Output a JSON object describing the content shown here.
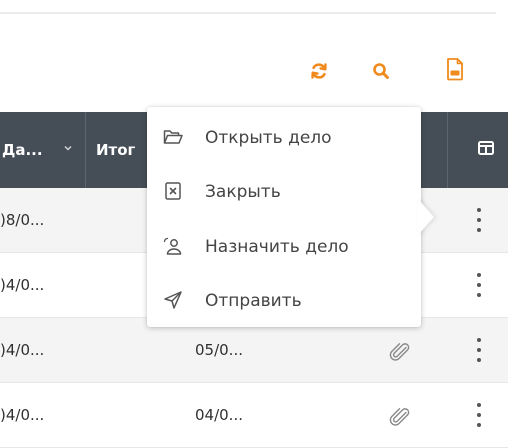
{
  "colors": {
    "accent": "#f08a1c",
    "header_bg": "#454d56",
    "icon_grey": "#666666"
  },
  "toolbar": {
    "icons": [
      "refresh-icon",
      "search-icon",
      "export-document-icon"
    ]
  },
  "table": {
    "columns": [
      {
        "label": "Да...",
        "sortable": true
      },
      {
        "label": "Итог"
      }
    ],
    "rows": [
      {
        "col1": ")8/0...",
        "col2": "",
        "attachment": false
      },
      {
        "col1": ")4/0...",
        "col2": "",
        "attachment": false
      },
      {
        "col1": ")4/0...",
        "col2": "05/0...",
        "attachment": true
      },
      {
        "col1": ")4/0...",
        "col2": "04/0...",
        "attachment": true
      }
    ]
  },
  "context_menu": {
    "items": [
      {
        "label": "Открыть дело",
        "icon": "folder-open-icon"
      },
      {
        "label": "Закрыть",
        "icon": "close-box-icon"
      },
      {
        "label": "Назначить дело",
        "icon": "assign-user-icon"
      },
      {
        "label": "Отправить",
        "icon": "send-icon"
      }
    ]
  }
}
